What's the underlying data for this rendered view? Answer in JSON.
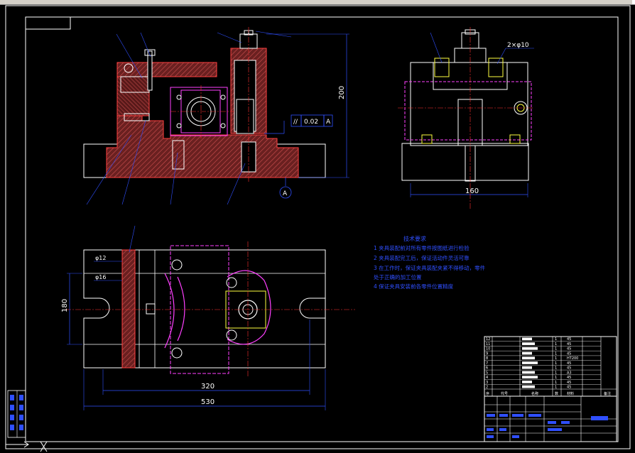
{
  "dimensions": {
    "height_front": "200",
    "width_side": "160",
    "width_inner": "320",
    "width_total": "530",
    "slot_dia1": "φ12",
    "slot_dia2": "φ16",
    "left_height": "180",
    "bolt_spec": "2×φ10",
    "section_mark": "A"
  },
  "tolerance": {
    "symbol": "//",
    "value": "0.02",
    "datum": "A"
  },
  "tech_notes": {
    "title": "技术要求",
    "items": [
      "1  夹具装配前对所有零件按图纸进行检验",
      "2  夹具装配完工后，保证活动件灵活可靠",
      "3  在工作时，保证夹具装配夹紧不得移动，零件",
      "   处于正确的加工位置",
      "4  保证夹具安装前各零件位置精度"
    ]
  },
  "parts_table": {
    "rows": [
      {
        "no": "12",
        "qty": "1",
        "mat": "45"
      },
      {
        "no": "11",
        "qty": "1",
        "mat": "45"
      },
      {
        "no": "10",
        "qty": "1",
        "mat": "45"
      },
      {
        "no": "9",
        "qty": "1",
        "mat": "45"
      },
      {
        "no": "8",
        "qty": "1",
        "mat": "HT200"
      },
      {
        "no": "7",
        "qty": "1",
        "mat": "45"
      },
      {
        "no": "6",
        "qty": "1",
        "mat": "45"
      },
      {
        "no": "5",
        "qty": "1",
        "mat": "A3"
      },
      {
        "no": "4",
        "qty": "1",
        "mat": "45"
      },
      {
        "no": "3",
        "qty": "1",
        "mat": "45"
      },
      {
        "no": "2",
        "qty": "1",
        "mat": "45"
      }
    ],
    "header": [
      "序",
      "代号",
      "名称",
      "数",
      "材料",
      "备注"
    ]
  },
  "colors": {
    "frame": "#ffffff",
    "part": "#ffffff",
    "section": "#ff4040",
    "hatch": "#c05050",
    "magenta": "#ff40ff",
    "center": "#ff3030",
    "dim": "#2f4fff",
    "leader": "#2f4fff",
    "yellow": "#ffff40",
    "green": "#40ff40"
  }
}
